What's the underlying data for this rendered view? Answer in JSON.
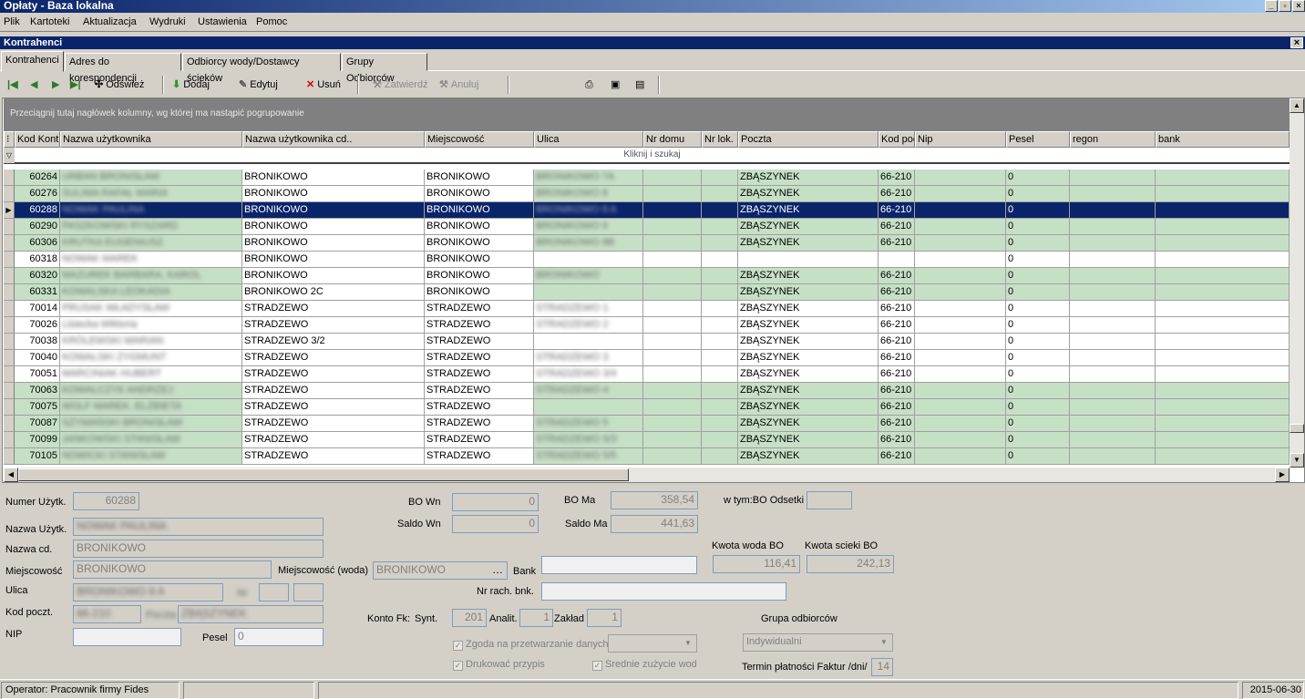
{
  "window": {
    "title": "Opłaty - Baza lokalna",
    "btn_min": "_",
    "btn_max": "▫",
    "btn_close": "×"
  },
  "menu": [
    "Plik",
    "Kartoteki",
    "Aktualizacja",
    "Wydruki",
    "Ustawienia",
    "Pomoc"
  ],
  "child": {
    "title": "Kontrahenci",
    "close": "×"
  },
  "tabs": [
    "Kontrahenci",
    "Adres do korespondencji",
    "Odbiorcy wody/Dostawcy ścieków",
    "Grupy Odbiorców"
  ],
  "toolbar": {
    "refresh": "Odśwież",
    "add": "Dodaj",
    "edit": "Edytuj",
    "delete": "Usuń",
    "confirm": "Zatwierdź",
    "cancel": "Anuluj"
  },
  "grid": {
    "group_hint": "Przeciągnij tutaj nagłówek kolumny, wg której ma nastąpić pogrupowanie",
    "filter_hint": "Kliknij i szukaj",
    "columns": [
      "Kod Kontr",
      "Nazwa użytkownika",
      "Nazwa użytkownika cd..",
      "Miejscowość",
      "Ulica",
      "Nr domu",
      "Nr lok.",
      "Poczta",
      "Kod poc",
      "Nip",
      "Pesel",
      "regon",
      "bank"
    ],
    "rows": [
      {
        "kod": "60264",
        "nazwa": "URBAN BRONISŁAW",
        "cd": "BRONIKOWO",
        "miejsc": "BRONIKOWO",
        "ulica": "BRONIKOWO 7A",
        "poczta": "ZBĄSZYNEK",
        "kodp": "66-210",
        "pesel": "0",
        "color": "#c6e0c6"
      },
      {
        "kod": "60276",
        "nazwa": "SULIMA RAFAŁ MARIA",
        "cd": "BRONIKOWO",
        "miejsc": "BRONIKOWO",
        "ulica": "BRONIKOWO 8",
        "poczta": "ZBĄSZYNEK",
        "kodp": "66-210",
        "pesel": "0",
        "color": "#c6e0c6"
      },
      {
        "kod": "60288",
        "nazwa": "NOWAK PAULINA",
        "cd": "BRONIKOWO",
        "miejsc": "BRONIKOWO",
        "ulica": "BRONIKOWO 8 A",
        "poczta": "ZBĄSZYNEK",
        "kodp": "66-210",
        "pesel": "0",
        "color": "#c6e0c6",
        "selected": true
      },
      {
        "kod": "60290",
        "nazwa": "PASZKOWSKI RYSZARD",
        "cd": "BRONIKOWO",
        "miejsc": "BRONIKOWO",
        "ulica": "BRONIKOWO 9",
        "poczta": "ZBĄSZYNEK",
        "kodp": "66-210",
        "pesel": "0",
        "color": "#c6e0c6"
      },
      {
        "kod": "60306",
        "nazwa": "KRUTKA EUGENIUSZ",
        "cd": "BRONIKOWO",
        "miejsc": "BRONIKOWO",
        "ulica": "BRONIKOWO 9B",
        "poczta": "ZBĄSZYNEK",
        "kodp": "66-210",
        "pesel": "0",
        "color": "#c6e0c6"
      },
      {
        "kod": "60318",
        "nazwa": "NOWAK MAREK",
        "cd": "BRONIKOWO",
        "miejsc": "BRONIKOWO",
        "ulica": "",
        "poczta": "",
        "kodp": "",
        "pesel": "0",
        "color": "#ffffff"
      },
      {
        "kod": "60320",
        "nazwa": "MAZUREK BARBARA, KAROL",
        "cd": "BRONIKOWO",
        "miejsc": "BRONIKOWO",
        "ulica": "BRONIKOWO",
        "poczta": "ZBĄSZYNEK",
        "kodp": "66-210",
        "pesel": "0",
        "color": "#c6e0c6"
      },
      {
        "kod": "60331",
        "nazwa": "KOWALSKA LEOKADIA",
        "cd": "BRONIKOWO 2C",
        "miejsc": "BRONIKOWO",
        "ulica": "",
        "poczta": "ZBĄSZYNEK",
        "kodp": "66-210",
        "pesel": "0",
        "color": "#c6e0c6"
      },
      {
        "kod": "70014",
        "nazwa": "PRUSAK WŁADYSŁAW",
        "cd": "STRADZEWO",
        "miejsc": "STRADZEWO",
        "ulica": "STRADZEWO 1",
        "poczta": "ZBĄSZYNEK",
        "kodp": "66-210",
        "pesel": "0",
        "color": "#ffffff"
      },
      {
        "kod": "70026",
        "nazwa": "Lisiecka Wiktoria",
        "cd": "STRADZEWO",
        "miejsc": "STRADZEWO",
        "ulica": "STRADZEWO 2",
        "poczta": "ZBĄSZYNEK",
        "kodp": "66-210",
        "pesel": "0",
        "color": "#ffffff"
      },
      {
        "kod": "70038",
        "nazwa": "KRÓLEWSKI MARIAN",
        "cd": "STRADZEWO 3/2",
        "miejsc": "STRADZEWO",
        "ulica": "",
        "poczta": "ZBĄSZYNEK",
        "kodp": "66-210",
        "pesel": "0",
        "color": "#ffffff"
      },
      {
        "kod": "70040",
        "nazwa": "KOWALSKI ZYGMUNT",
        "cd": "STRADZEWO",
        "miejsc": "STRADZEWO",
        "ulica": "STRADZEWO 3",
        "poczta": "ZBĄSZYNEK",
        "kodp": "66-210",
        "pesel": "0",
        "color": "#ffffff"
      },
      {
        "kod": "70051",
        "nazwa": "MARCINIAK HUBERT",
        "cd": "STRADZEWO",
        "miejsc": "STRADZEWO",
        "ulica": "STRADZEWO 3/4",
        "poczta": "ZBĄSZYNEK",
        "kodp": "66-210",
        "pesel": "0",
        "color": "#ffffff"
      },
      {
        "kod": "70063",
        "nazwa": "KOWALCZYK ANDRZEJ",
        "cd": "STRADZEWO",
        "miejsc": "STRADZEWO",
        "ulica": "STRADZEWO 4",
        "poczta": "ZBĄSZYNEK",
        "kodp": "66-210",
        "pesel": "0",
        "color": "#c6e0c6"
      },
      {
        "kod": "70075",
        "nazwa": "WOLF MAREK, ELŻBIETA",
        "cd": "STRADZEWO",
        "miejsc": "STRADZEWO",
        "ulica": "",
        "poczta": "ZBĄSZYNEK",
        "kodp": "66-210",
        "pesel": "0",
        "color": "#c6e0c6"
      },
      {
        "kod": "70087",
        "nazwa": "SZYMAŃSKI BRONISŁAW",
        "cd": "STRADZEWO",
        "miejsc": "STRADZEWO",
        "ulica": "STRADZEWO 5",
        "poczta": "ZBĄSZYNEK",
        "kodp": "66-210",
        "pesel": "0",
        "color": "#c6e0c6"
      },
      {
        "kod": "70099",
        "nazwa": "JANKOWSKI STANISŁAW",
        "cd": "STRADZEWO",
        "miejsc": "STRADZEWO",
        "ulica": "STRADZEWO 5/3",
        "poczta": "ZBĄSZYNEK",
        "kodp": "66-210",
        "pesel": "0",
        "color": "#c6e0c6"
      },
      {
        "kod": "70105",
        "nazwa": "NOWICKI STANISŁAW",
        "cd": "STRADZEWO",
        "miejsc": "STRADZEWO",
        "ulica": "STRADZEWO 5/5",
        "poczta": "ZBĄSZYNEK",
        "kodp": "66-210",
        "pesel": "0",
        "color": "#c6e0c6"
      }
    ]
  },
  "form": {
    "numer_label": "Numer Użytk.",
    "numer": "60288",
    "nazwa_label": "Nazwa Użytk.",
    "nazwa": "NOWAK PAULINA",
    "nazwacd_label": "Nazwa cd.",
    "nazwacd": "BRONIKOWO",
    "miejsc_label": "Miejscowość",
    "miejsc": "BRONIKOWO",
    "miejsc_woda_label": "Miejscowość (woda)",
    "miejsc_woda": "BRONIKOWO",
    "ulica_label": "Ulica",
    "ulica": "BRONIKOWO 8 A",
    "nr_label": "Nr",
    "kod_label": "Kod poczt.",
    "kod": "66-210",
    "poczta_label": "Poczta",
    "poczta": "ZBĄSZYNEK",
    "nip_label": "NIP",
    "pesel_label": "Pesel",
    "pesel": "0",
    "bo_wn_label": "BO Wn",
    "bo_wn": "0",
    "saldo_wn_label": "Saldo Wn",
    "saldo_wn": "0",
    "bo_ma_label": "BO Ma",
    "bo_ma": "358,54",
    "saldo_ma_label": "Saldo Ma",
    "saldo_ma": "441,63",
    "odsetki_label": "w tym:BO Odsetki",
    "odsetki": "",
    "kwota_woda_label": "Kwota woda BO",
    "kwota_woda": "116,41",
    "kwota_scieki_label": "Kwota scieki BO",
    "kwota_scieki": "242,13",
    "bank_label": "Bank",
    "nr_rach_label": "Nr rach. bnk.",
    "konto_label": "Konto Fk:",
    "synt_label": "Synt.",
    "synt": "201",
    "analit_label": "Analit.",
    "analit": "1",
    "zaklad_label": "Zakład",
    "zaklad": "1",
    "zgoda": "Zgoda na przetwarzanie danych",
    "drukowac": "Drukować przypis",
    "srednie": "Średnie zużycie wody",
    "grupa_label": "Grupa odbiorców",
    "grupa": "Indywidualni",
    "termin_label": "Termin płatności Faktur /dni/",
    "termin": "14"
  },
  "status": {
    "operator": "Operator: Pracownik firmy Fides",
    "date": "2015-06-30"
  }
}
